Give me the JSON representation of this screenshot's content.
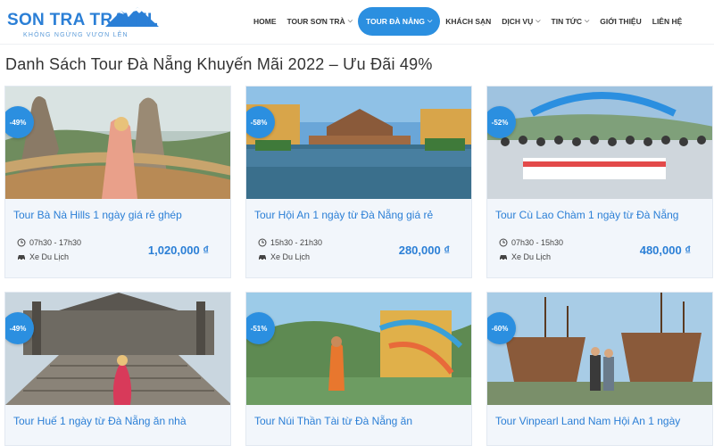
{
  "brand": {
    "name": "SON TRA TRAVEL",
    "slogan": "KHÔNG NGỪNG VƯƠN LÊN",
    "color": "#2b7fd6"
  },
  "nav": {
    "items": [
      {
        "label": "HOME",
        "has_dropdown": false
      },
      {
        "label": "TOUR SƠN TRÀ",
        "has_dropdown": true
      },
      {
        "label": "TOUR ĐÀ NẴNG",
        "has_dropdown": true,
        "active": true
      },
      {
        "label": "KHÁCH SẠN",
        "has_dropdown": false
      },
      {
        "label": "DỊCH VỤ",
        "has_dropdown": true
      },
      {
        "label": "TIN TỨC",
        "has_dropdown": true
      },
      {
        "label": "GIỚI THIỆU",
        "has_dropdown": false
      },
      {
        "label": "LIÊN HỆ",
        "has_dropdown": false
      }
    ],
    "active_color": "#2b8fe0"
  },
  "page": {
    "title": "Danh Sách Tour Đà Nẵng Khuyến Mãi 2022 – Ưu Đãi 49%"
  },
  "cards": [
    {
      "badge": "-49%",
      "title": "Tour Bà Nà Hills 1 ngày giá rẻ ghép",
      "time": "07h30 - 17h30",
      "transport": "Xe Du Lịch",
      "price": "1,020,000 ₫",
      "image_icon": "golden-bridge-image"
    },
    {
      "badge": "-58%",
      "title": "Tour Hội An 1 ngày từ Đà Nẵng giá rẻ",
      "time": "15h30 - 21h30",
      "transport": "Xe Du Lịch",
      "price": "280,000 ₫",
      "image_icon": "hoi-an-bridge-image"
    },
    {
      "badge": "-52%",
      "title": "Tour Cù Lao Chàm 1 ngày từ Đà Nẵng",
      "time": "07h30 - 15h30",
      "transport": "Xe Du Lịch",
      "price": "480,000 ₫",
      "image_icon": "group-photo-image"
    },
    {
      "badge": "-49%",
      "title": "Tour Huế 1 ngày từ Đà Nẵng ăn nhà",
      "image_icon": "hue-tomb-image"
    },
    {
      "badge": "-51%",
      "title": "Tour Núi Thần Tài từ Đà Nẵng ăn",
      "image_icon": "water-park-image"
    },
    {
      "badge": "-60%",
      "title": "Tour Vinpearl Land Nam Hội An 1 ngày",
      "image_icon": "vinpearl-ships-image"
    }
  ]
}
